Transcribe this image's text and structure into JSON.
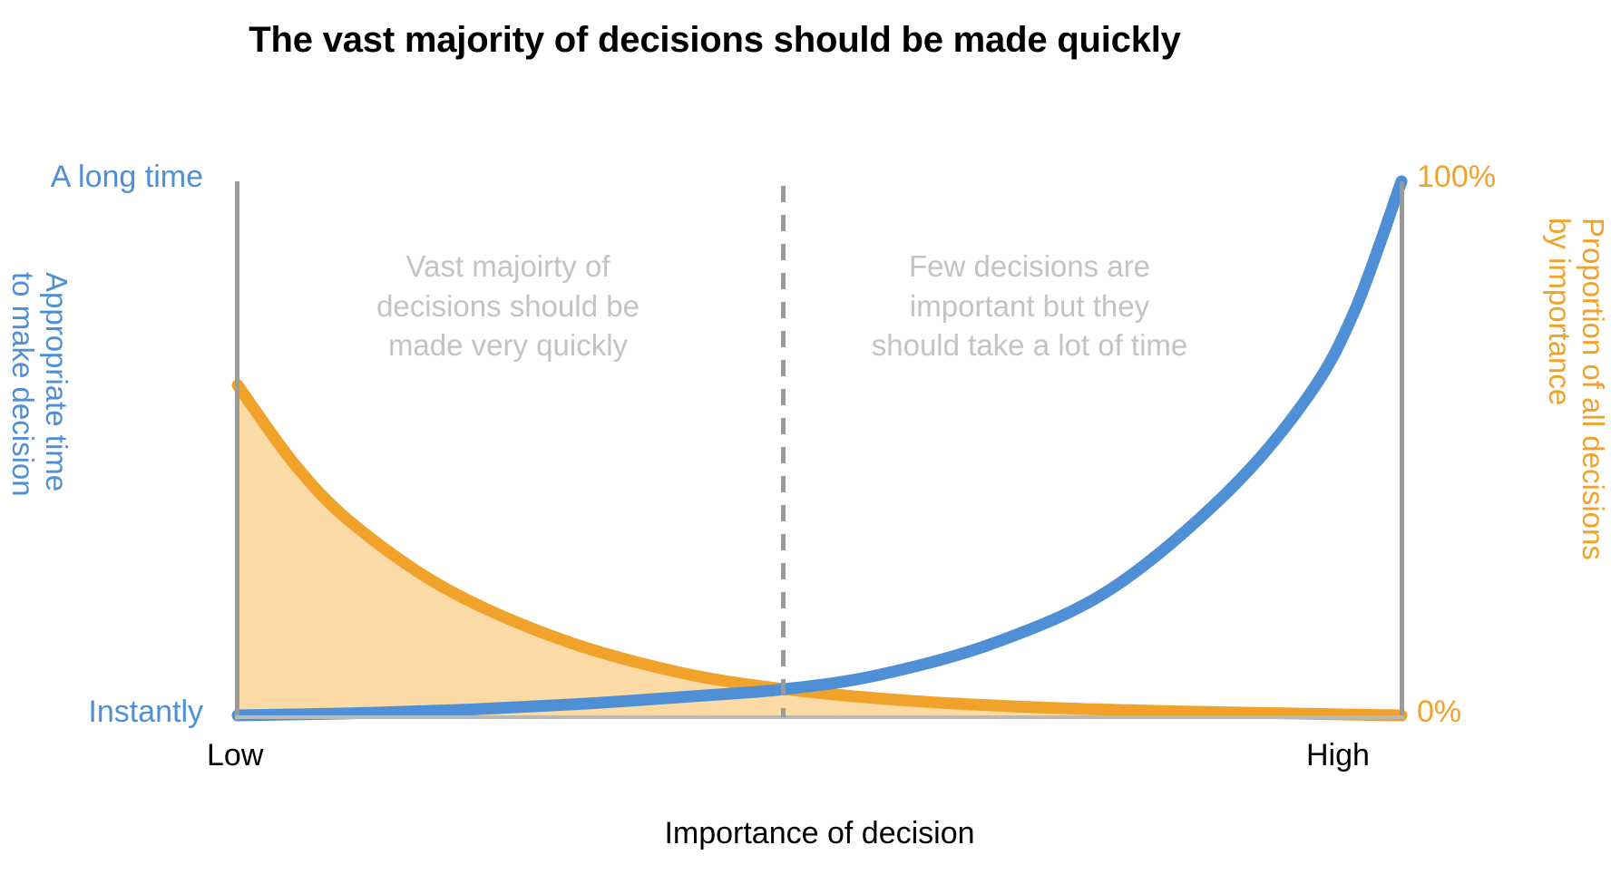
{
  "title": "The vast majority of decisions should be made quickly",
  "axes": {
    "x_title": "Importance of decision",
    "x_ticks": [
      "Low",
      "High"
    ],
    "y_left_title": "Appropriate time\nto make decision",
    "y_left_ticks": [
      "A long time",
      "Instantly"
    ],
    "y_right_title": "Proportion of all decisions\nby importance",
    "y_right_ticks": [
      "100%",
      "0%"
    ]
  },
  "annotations": [
    "Vast majoirty of\ndecisions should be\nmade very quickly",
    "Few decisions are\nimportant but they\nshould take a lot of time"
  ],
  "colors": {
    "blue": "#4f8fd6",
    "orange": "#f1a22b",
    "orange_fill": "#fbdaa6",
    "axis_gray": "#9a9a9a",
    "annotation_gray": "#c3c3c3",
    "title_black": "#000000"
  },
  "chart_data": {
    "type": "line",
    "title": "The vast majority of decisions should be made quickly",
    "xlabel": "Importance of decision",
    "grid": false,
    "legend": "none",
    "x_tick_labels": [
      "Low",
      "High"
    ],
    "xlim": [
      0,
      1
    ],
    "divider_x": 0.47,
    "divider_style": "dashed",
    "crossing_point": {
      "x": 0.47,
      "y_pct": 5
    },
    "series": [
      {
        "name": "Appropriate time to make decision",
        "color": "#4f8fd6",
        "axis": "left",
        "ylabel": "Appropriate time to make decision",
        "y_tick_labels": [
          "Instantly",
          "A long time"
        ],
        "ylim": [
          0,
          100
        ],
        "shape": "exponential growth",
        "filled": false,
        "x": [
          0.0,
          0.1,
          0.2,
          0.3,
          0.4,
          0.47,
          0.55,
          0.65,
          0.75,
          0.85,
          0.92,
          0.96,
          1.0
        ],
        "y": [
          0.5,
          0.9,
          1.6,
          2.7,
          4.2,
          5.4,
          8.0,
          14.0,
          24.0,
          42.0,
          60.0,
          76.0,
          100.0
        ]
      },
      {
        "name": "Proportion of all decisions by importance",
        "color": "#f1a22b",
        "fill_color": "#fbdaa6",
        "axis": "right",
        "ylabel": "Proportion of all decisions by importance",
        "y_tick_labels": [
          "0%",
          "100%"
        ],
        "ylim": [
          0,
          100
        ],
        "shape": "exponential decay",
        "filled": true,
        "x": [
          0.0,
          0.05,
          0.1,
          0.18,
          0.28,
          0.38,
          0.47,
          0.58,
          0.7,
          0.82,
          0.92,
          1.0
        ],
        "y": [
          62.0,
          47.0,
          36.0,
          24.0,
          14.5,
          8.5,
          5.4,
          3.2,
          1.9,
          1.2,
          0.8,
          0.5
        ]
      }
    ]
  }
}
